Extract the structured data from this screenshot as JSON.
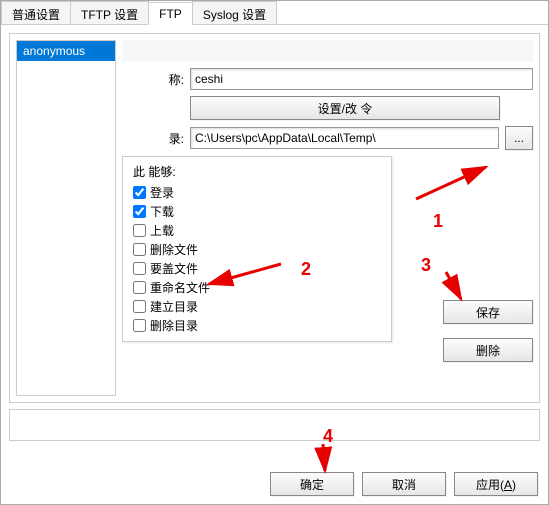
{
  "tabs": {
    "t0": "普通设置",
    "t1": "TFTP 设置",
    "t2": "FTP",
    "t3": "Syslog 设置"
  },
  "userlist": {
    "item0": "anonymous"
  },
  "labels": {
    "name": "称:",
    "dir": "录:",
    "permTitle": "此     能够:"
  },
  "fields": {
    "name_value": "ceshi",
    "dir_value": "C:\\Users\\pc\\AppData\\Local\\Temp\\"
  },
  "buttons": {
    "setpwd": "设置/改         令",
    "browse": "...",
    "save": "保存",
    "delete": "删除",
    "ok": "确定",
    "cancel": "取消",
    "apply_prefix": "应用(",
    "apply_hot": "A",
    "apply_suffix": ")"
  },
  "perms": {
    "p0": "登录",
    "p1": "下载",
    "p2": "上载",
    "p3": "删除文件",
    "p4": "要盖文件",
    "p5": "重命名文件",
    "p6": "建立目录",
    "p7": "删除目录"
  },
  "checked": {
    "p0": true,
    "p1": true,
    "p2": false,
    "p3": false,
    "p4": false,
    "p5": false,
    "p6": false,
    "p7": false
  },
  "anno": {
    "a1": "1",
    "a2": "2",
    "a3": "3",
    "a4": "4"
  }
}
